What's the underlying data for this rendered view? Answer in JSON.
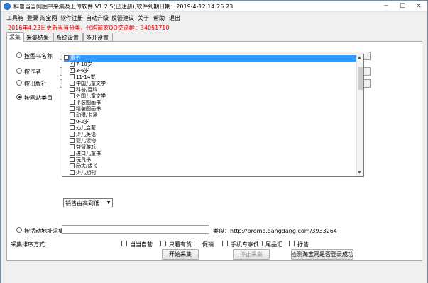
{
  "window": {
    "title": "科普当当网图书采集及上传软件:V1.2.5(已注册),软件到期日期：2019-4-12 14:25:23",
    "minimize": "─",
    "maximize": "☐",
    "close": "✕"
  },
  "menu": [
    "工具箱",
    "登录 淘宝网",
    "软件注册",
    "自动升级",
    "反馈建议",
    "关于",
    "帮助",
    "退出"
  ],
  "notice": "2016年4.23日更新当当分类，代购商家QQ交流群：34051710",
  "tabs": [
    "采集",
    "采集结果",
    "系统设置",
    "多开设置"
  ],
  "search": {
    "by_title": "按图书名称",
    "by_author": "按作者",
    "by_publisher": "按出版社",
    "by_category": "按网站类目",
    "by_activity": "按活动地址采集",
    "example": "类似：http://promo.dangdang.com/3933264"
  },
  "categories": [
    {
      "label": "童书",
      "checked": false,
      "head": true
    },
    {
      "label": "7-10岁",
      "checked": true
    },
    {
      "label": "3-6岁",
      "checked": true
    },
    {
      "label": "11-14岁",
      "checked": false
    },
    {
      "label": "中国儿童文学",
      "checked": false
    },
    {
      "label": "科普/百科",
      "checked": false
    },
    {
      "label": "外国儿童文学",
      "checked": false
    },
    {
      "label": "平装图画书",
      "checked": false
    },
    {
      "label": "精装图画书",
      "checked": false
    },
    {
      "label": "动漫/卡通",
      "checked": false
    },
    {
      "label": "0-2岁",
      "checked": false
    },
    {
      "label": "幼儿启蒙",
      "checked": false
    },
    {
      "label": "少儿英语",
      "checked": false
    },
    {
      "label": "婴儿读物",
      "checked": false
    },
    {
      "label": "益智游戏",
      "checked": false
    },
    {
      "label": "进口儿童书",
      "checked": false
    },
    {
      "label": "玩具书",
      "checked": false
    },
    {
      "label": "励志/成长",
      "checked": false
    },
    {
      "label": "少儿期刊",
      "checked": false
    }
  ],
  "sort": {
    "label": "采集排序方式：",
    "selected": "销售由高到低"
  },
  "filters": [
    "当当自营",
    "只看有货",
    "促销",
    "手机专享价",
    "尾品汇",
    "抒售"
  ],
  "buttons": {
    "start": "开始采集",
    "stop": "停止采集",
    "check_login": "检测淘宝网是否登录成功"
  }
}
